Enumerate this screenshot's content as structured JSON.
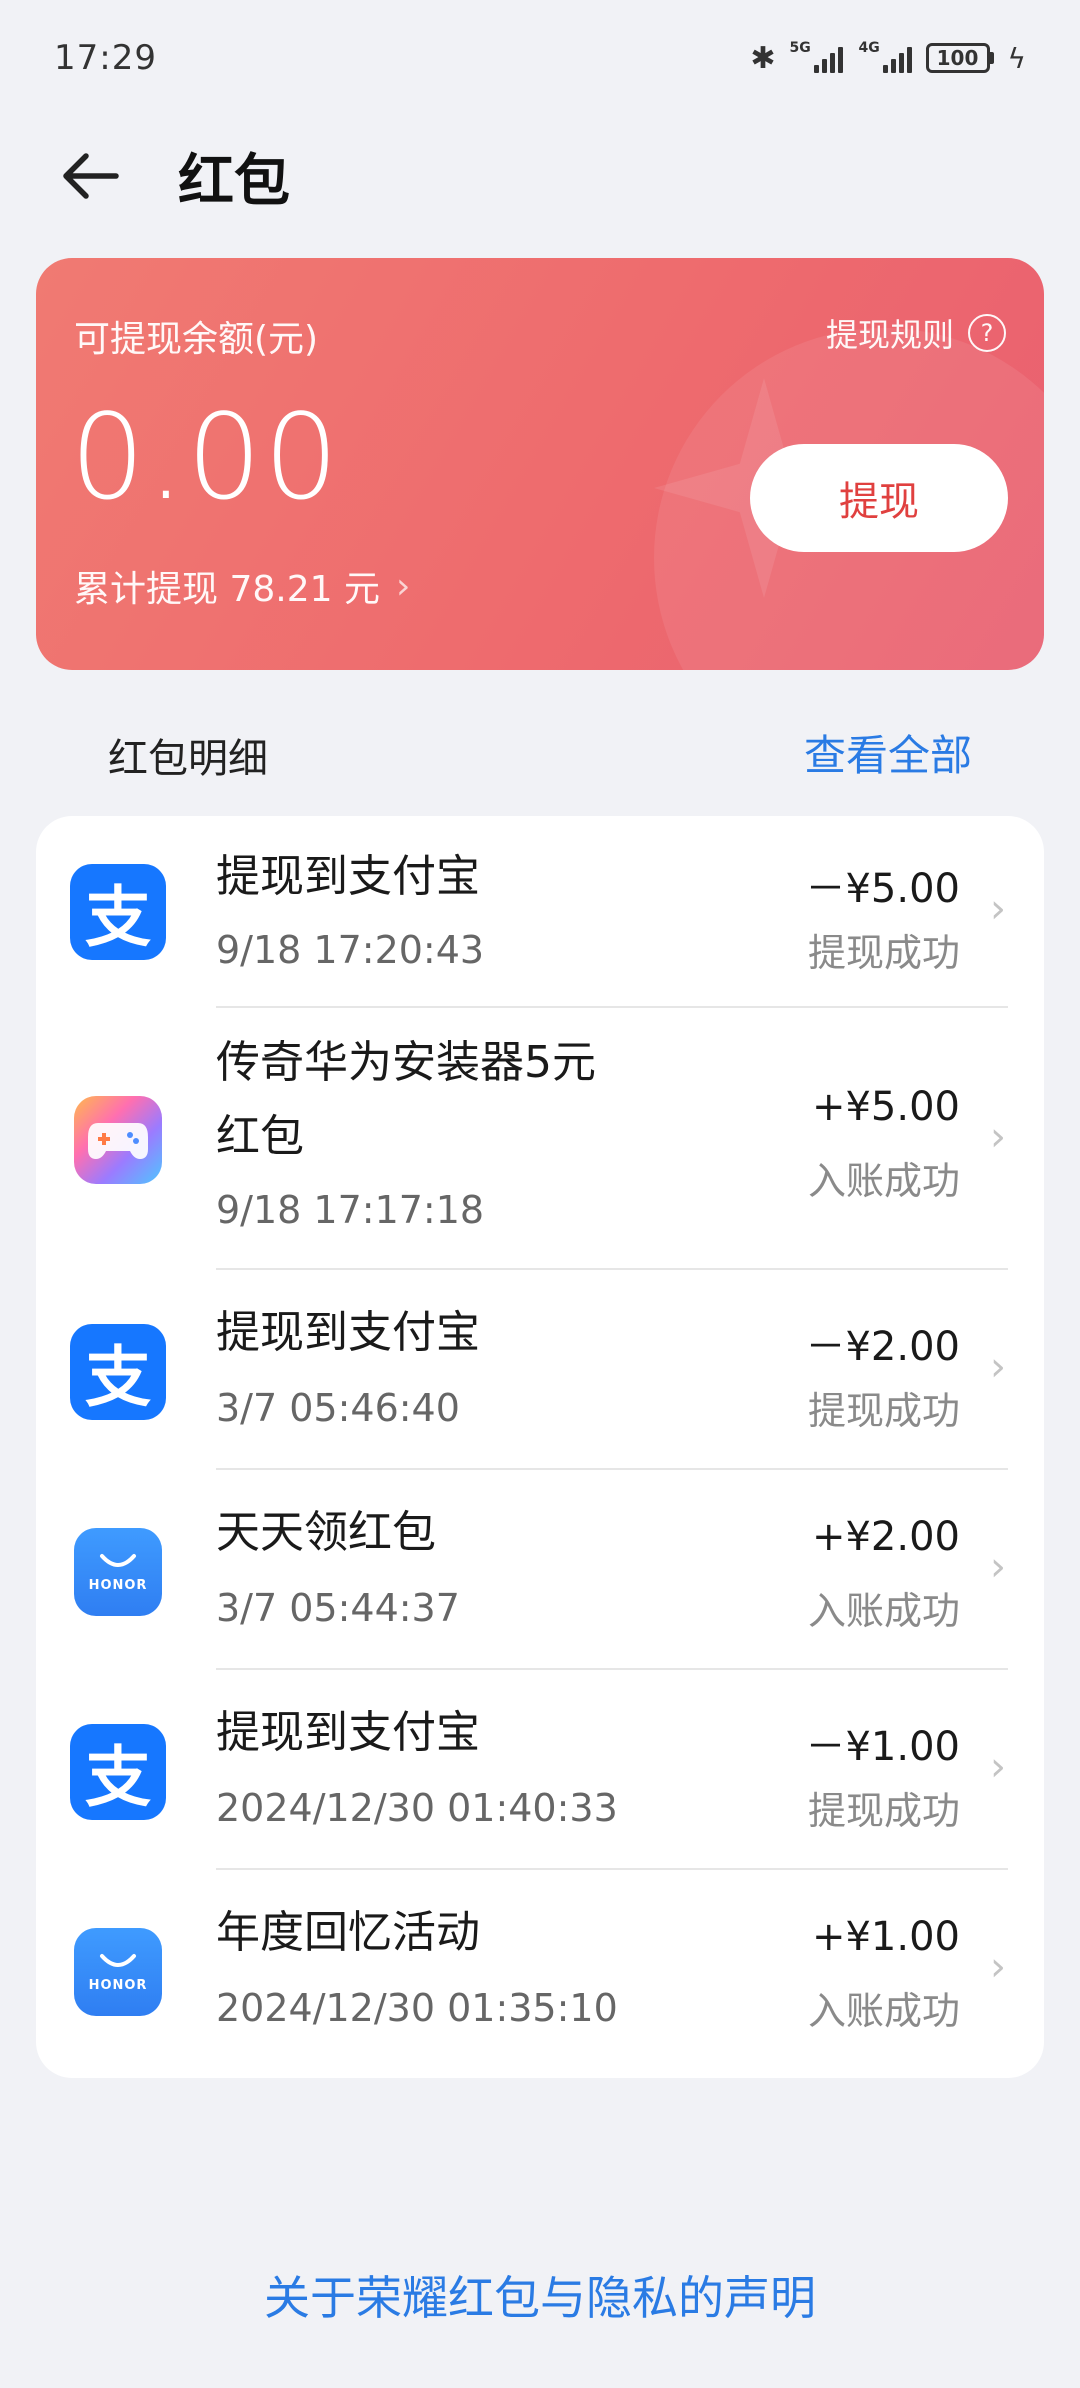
{
  "status_bar": {
    "time": "17:29",
    "network_1": "5G",
    "network_2": "4G",
    "battery": "100"
  },
  "header": {
    "title": "红包"
  },
  "balance_card": {
    "label": "可提现余额(元)",
    "rules_label": "提现规则",
    "amount": "0.00",
    "total_withdrawn": "累计提现 78.21 元",
    "withdraw_button": "提现"
  },
  "details": {
    "title": "红包明细",
    "view_all": "查看全部",
    "items": [
      {
        "icon": "alipay-icon",
        "title": "提现到支付宝",
        "title_line2": "",
        "time": "9/18 17:20:43",
        "amount": "－¥5.00",
        "status": "提现成功"
      },
      {
        "icon": "game-icon",
        "title": "传奇华为安装器5元",
        "title_line2": "红包",
        "time": "9/18 17:17:18",
        "amount": "+¥5.00",
        "status": "入账成功"
      },
      {
        "icon": "alipay-icon",
        "title": "提现到支付宝",
        "title_line2": "",
        "time": "3/7 05:46:40",
        "amount": "－¥2.00",
        "status": "提现成功"
      },
      {
        "icon": "honor-icon",
        "title": "天天领红包",
        "title_line2": "",
        "time": "3/7 05:44:37",
        "amount": "+¥2.00",
        "status": "入账成功"
      },
      {
        "icon": "alipay-icon",
        "title": "提现到支付宝",
        "title_line2": "",
        "time": "2024/12/30 01:40:33",
        "amount": "－¥1.00",
        "status": "提现成功"
      },
      {
        "icon": "honor-icon",
        "title": "年度回忆活动",
        "title_line2": "",
        "time": "2024/12/30 01:35:10",
        "amount": "+¥1.00",
        "status": "入账成功"
      }
    ]
  },
  "icons": {
    "alipay_glyph": "支",
    "honor_text": "HONOR"
  },
  "footer": {
    "privacy_link": "关于荣耀红包与隐私的声明"
  },
  "colors": {
    "card_gradient_start": "#f07a72",
    "card_gradient_end": "#e95f70",
    "link_blue": "#2a7be4",
    "alipay_blue": "#1677ff",
    "withdraw_text": "#e0403f"
  }
}
